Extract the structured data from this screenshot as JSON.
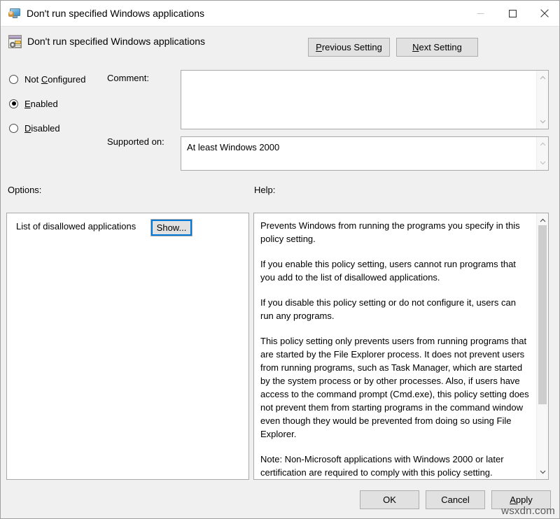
{
  "window": {
    "title": "Don't run specified Windows applications",
    "title_icon": "monitor-user-icon",
    "controls": {
      "minimize": "minimize-icon",
      "maximize": "maximize-icon",
      "close": "close-icon"
    }
  },
  "header": {
    "title": "Don't run specified Windows applications",
    "icon": "policy-setting-icon",
    "previous_label_pre": "P",
    "previous_label_post": "revious Setting",
    "next_label_pre": "N",
    "next_label_post": "ext Setting"
  },
  "state": {
    "selected": "Enabled",
    "options": [
      {
        "id": "not-configured",
        "pre": "Not ",
        "accel": "C",
        "post": "onfigured",
        "checked": false
      },
      {
        "id": "enabled",
        "pre": "",
        "accel": "E",
        "post": "nabled",
        "checked": true
      },
      {
        "id": "disabled",
        "pre": "",
        "accel": "D",
        "post": "isabled",
        "checked": false
      }
    ]
  },
  "fields": {
    "comment_label": "Comment:",
    "comment_value": "",
    "comment_placeholder": "",
    "supported_label": "Supported on:",
    "supported_value": "At least Windows 2000"
  },
  "panels": {
    "options_label": "Options:",
    "help_label": "Help:",
    "option_row_label": "List of disallowed applications",
    "show_button_label": "Show..."
  },
  "help": {
    "paragraphs": [
      "Prevents Windows from running the programs you specify in this policy setting.",
      "If you enable this policy setting, users cannot run programs that you add to the list of disallowed applications.",
      "If you disable this policy setting or do not configure it, users can run any programs.",
      "This policy setting only prevents users from running programs that are started by the File Explorer process. It does not prevent users from running programs, such as Task Manager, which are started by the system process or by other processes.  Also, if users have access to the command prompt (Cmd.exe), this policy setting does not prevent them from starting programs in the command window even though they would be prevented from doing so using File Explorer.",
      "Note: Non-Microsoft applications with Windows 2000 or later certification are required to comply with this policy setting."
    ]
  },
  "footer": {
    "ok_label": "OK",
    "cancel_label": "Cancel",
    "apply_accel": "A",
    "apply_post": "pply"
  },
  "watermark": "wsxdn.com",
  "colors": {
    "dialog_background": "#f0f0f0",
    "titlebar_background": "#ffffff",
    "field_background": "#ffffff",
    "button_face": "#e1e1e1",
    "button_border": "#adadad",
    "focus_accent": "#0078d7",
    "scrollbar_thumb": "#cdcdcd",
    "text": "#000000"
  }
}
